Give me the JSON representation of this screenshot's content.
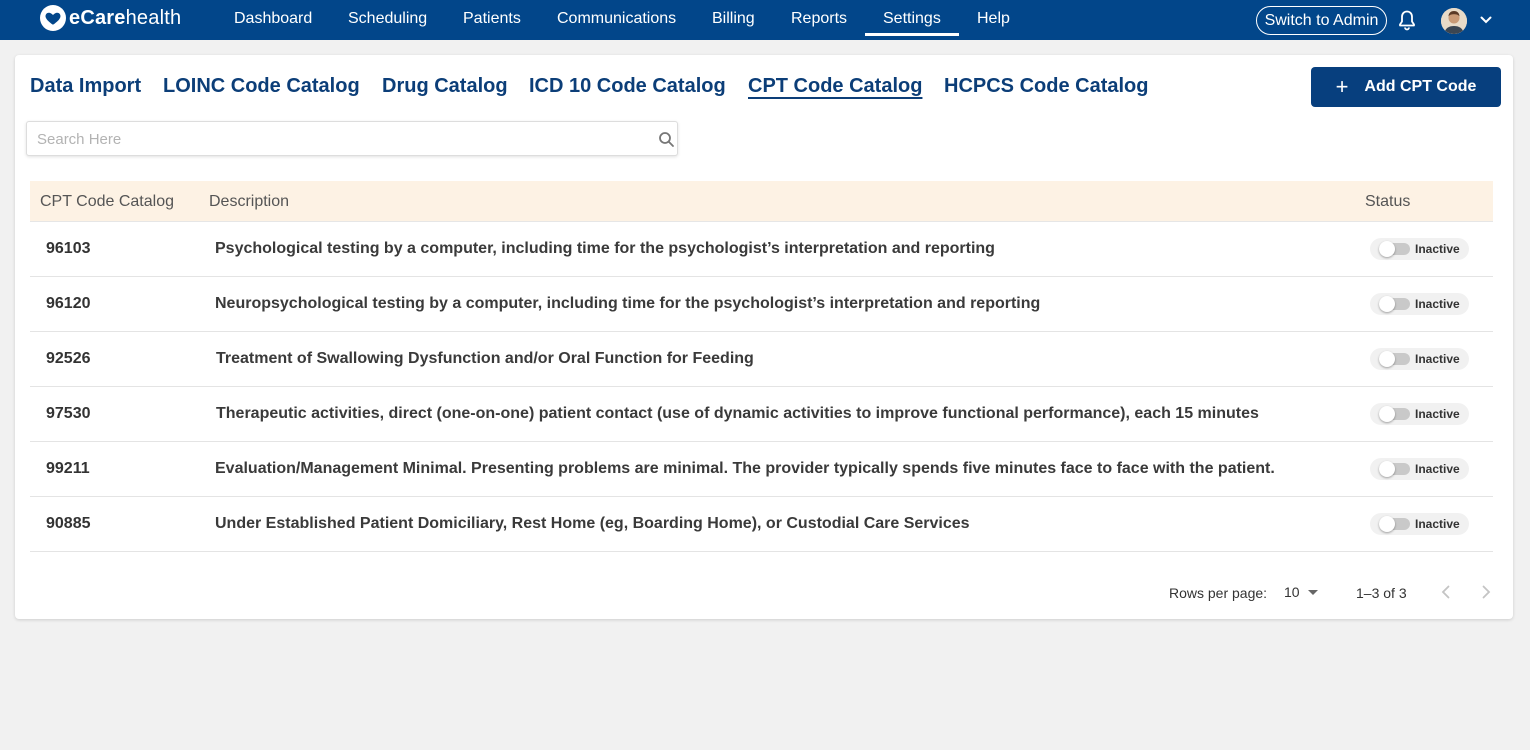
{
  "brand": {
    "name_bold": "eCare",
    "name_rest": "health"
  },
  "nav": {
    "items": [
      "Dashboard",
      "Scheduling",
      "Patients",
      "Communications",
      "Billing",
      "Reports",
      "Settings",
      "Help"
    ],
    "active": "Settings",
    "switch_admin_label": "Switch to Admin"
  },
  "tabs": {
    "items": [
      "Data Import",
      "LOINC Code Catalog",
      "Drug Catalog",
      "ICD 10 Code Catalog",
      "CPT Code Catalog",
      "HCPCS Code Catalog"
    ],
    "active": "CPT Code Catalog"
  },
  "add_button": {
    "label": "Add CPT Code",
    "icon": "plus-icon"
  },
  "search": {
    "placeholder": "Search Here",
    "value": ""
  },
  "table": {
    "columns": [
      "CPT Code Catalog",
      "Description",
      "Status"
    ],
    "rows": [
      {
        "code": "96103",
        "description": "Psychological testing by a computer, including time for the psychologist’s interpretation and reporting",
        "status": "Inactive"
      },
      {
        "code": "96120",
        "description": "Neuropsychological testing by a computer, including time for the psychologist’s interpretation and reporting",
        "status": "Inactive"
      },
      {
        "code": "92526",
        "description": "Treatment of Swallowing Dysfunction and/or Oral Function for Feeding",
        "status": "Inactive"
      },
      {
        "code": "97530",
        "description": "Therapeutic activities, direct (one-on-one) patient contact (use of dynamic activities to improve functional performance), each 15 minutes",
        "status": "Inactive"
      },
      {
        "code": "99211",
        "description": "Evaluation/Management Minimal. Presenting problems are minimal. The provider typically spends five minutes face to face with the patient.",
        "status": "Inactive"
      },
      {
        "code": "90885",
        "description": "Under Established Patient Domiciliary, Rest Home (eg, Boarding Home), or Custodial Care Services",
        "status": "Inactive"
      }
    ]
  },
  "pagination": {
    "rows_per_page_label": "Rows per page:",
    "rows_per_page_value": "10",
    "range_text": "1–3 of 3"
  },
  "colors": {
    "nav_bg": "#02468a",
    "accent": "#073f7e",
    "table_header_bg": "#fdf2e4"
  }
}
